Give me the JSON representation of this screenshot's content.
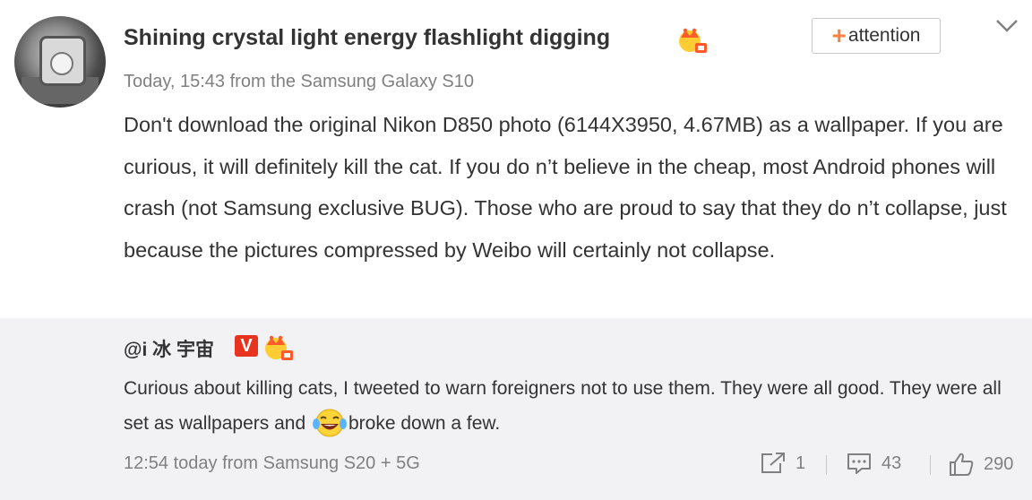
{
  "post": {
    "username": "Shining crystal light energy flashlight digging",
    "follow_button": "attention",
    "meta": "Today, 15:43 from the Samsung Galaxy S10",
    "text": "Don't download the original Nikon D850 photo (6144X3950, 4.67MB) as a wallpaper. If you are curious, it will definitely kill the cat. If you do n’t believe in the cheap, most Android phones will crash (not Samsung exclusive BUG). Those who are proud to say that they do n’t collapse, just because the pictures compressed by Weibo will certainly not collapse."
  },
  "repost": {
    "username": "@i 冰 宇宙",
    "verified_badge": "V",
    "text_before_emoji": "Curious about killing cats, I tweeted to warn foreigners not to use them. They were all good. They were all set as wallpapers and ",
    "emoji": "laughing-tears-emoji",
    "text_after_emoji": "broke down a few.",
    "meta": "12:54 today from Samsung S20 + 5G",
    "actions": {
      "repost_count": "1",
      "comment_count": "43",
      "like_count": "290"
    }
  },
  "icons": [
    "crown-badge-icon",
    "plus-icon",
    "chevron-down-icon",
    "repost-icon",
    "comment-icon",
    "like-icon"
  ],
  "colors": {
    "accent": "#ff8140",
    "verified": "#e8331f",
    "repost_bg": "#f2f2f5",
    "meta_text": "#808080"
  }
}
